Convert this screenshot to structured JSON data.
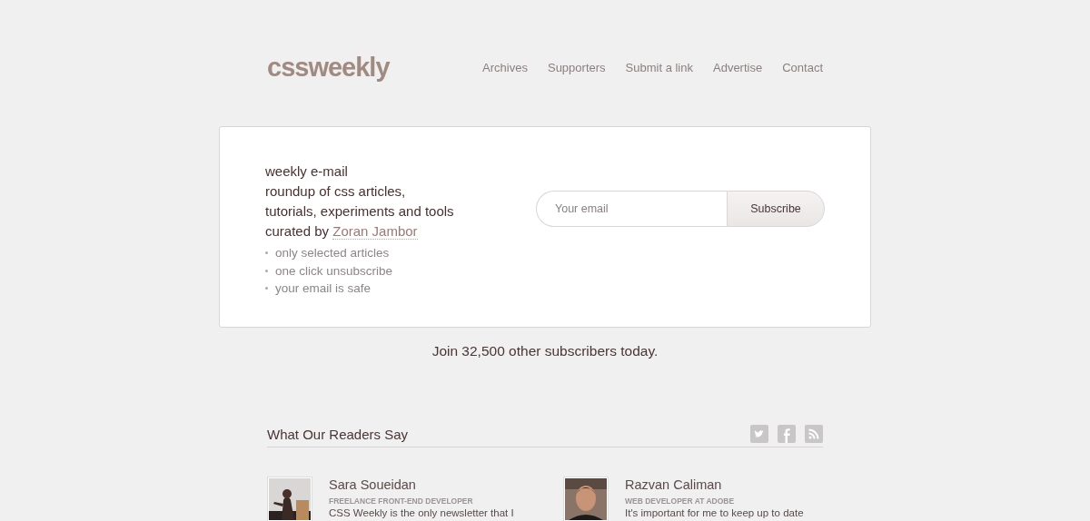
{
  "logo": "cssweekly",
  "nav": [
    "Archives",
    "Supporters",
    "Submit a link",
    "Advertise",
    "Contact"
  ],
  "signup": {
    "lines": [
      "weekly e-mail",
      "roundup of css articles,",
      "tutorials, experiments and tools"
    ],
    "curated_prefix": "curated by",
    "author_link": "Zoran Jambor",
    "benefits": [
      "only selected articles",
      "one click unsubscribe",
      "your email is safe"
    ],
    "email_placeholder": "Your email",
    "button": "Subscribe"
  },
  "subscribers": "Join 32,500 other subscribers today.",
  "readers": {
    "title": "What Our Readers Say",
    "social": [
      {
        "kind": "twitter"
      },
      {
        "kind": "facebook"
      },
      {
        "kind": "rss"
      }
    ],
    "testimonials": [
      {
        "name": "Sara Soueidan",
        "role": "FREELANCE FRONT-END DEVELOPER",
        "quote": "CSS Weekly is the only newsletter that I"
      },
      {
        "name": "Razvan Caliman",
        "role": "WEB DEVELOPER AT ADOBE",
        "quote": "It's important for me to keep up to date"
      }
    ]
  }
}
